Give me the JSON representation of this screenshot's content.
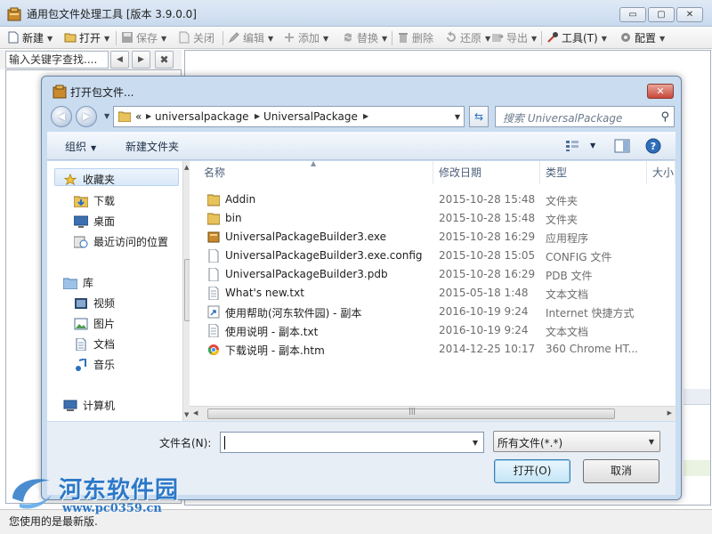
{
  "main_window": {
    "title": "通用包文件处理工具 [版本 3.9.0.0]",
    "controls": {
      "minimize": "▭",
      "maximize": "▢",
      "close": "✕"
    },
    "toolbar": [
      {
        "label": "新建",
        "icon": "new-file-icon",
        "dropdown": true,
        "disabled": false
      },
      {
        "label": "打开",
        "icon": "open-folder-icon",
        "dropdown": true,
        "disabled": false
      },
      {
        "label": "保存",
        "icon": "save-icon",
        "dropdown": true,
        "disabled": true
      },
      {
        "label": "关闭",
        "icon": "close-file-icon",
        "dropdown": false,
        "disabled": true
      },
      {
        "label": "编辑",
        "icon": "edit-icon",
        "dropdown": true,
        "disabled": true
      },
      {
        "label": "添加",
        "icon": "add-icon",
        "dropdown": true,
        "disabled": true
      },
      {
        "label": "替换",
        "icon": "replace-icon",
        "dropdown": true,
        "disabled": true
      },
      {
        "label": "删除",
        "icon": "delete-icon",
        "dropdown": false,
        "disabled": true
      },
      {
        "label": "还原",
        "icon": "restore-icon",
        "dropdown": true,
        "disabled": true
      },
      {
        "label": "导出",
        "icon": "export-icon",
        "dropdown": true,
        "disabled": true
      },
      {
        "label": "工具(T)",
        "icon": "tools-icon",
        "dropdown": true,
        "disabled": false
      },
      {
        "label": "配置",
        "icon": "gear-icon",
        "dropdown": true,
        "disabled": false
      }
    ],
    "search_placeholder": "输入关键字查找....",
    "nav_prev": "◀",
    "nav_next": "▶",
    "clear_symbol": "✖",
    "status": "您使用的是最新版."
  },
  "dialog": {
    "title": "打开包文件...",
    "close_symbol": "✕",
    "back_symbol": "◀",
    "forward_symbol": "▶",
    "address": {
      "overflow": "«",
      "items": [
        "universalpackage",
        "UniversalPackage"
      ]
    },
    "refresh_symbol": "⇆",
    "search_placeholder": "搜索 UniversalPackage",
    "toolbar": {
      "organize": "组织",
      "new_folder": "新建文件夹"
    },
    "nav": {
      "favorites": "收藏夹",
      "favorites_items": [
        "下载",
        "桌面",
        "最近访问的位置"
      ],
      "libraries": "库",
      "library_items": [
        "视频",
        "图片",
        "文档",
        "音乐"
      ],
      "computer": "计算机"
    },
    "columns": {
      "name": "名称",
      "date": "修改日期",
      "type": "类型",
      "size": "大小"
    },
    "files": [
      {
        "name": "Addin",
        "date": "2015-10-28 15:48",
        "type": "文件夹",
        "icon": "folder-icon"
      },
      {
        "name": "bin",
        "date": "2015-10-28 15:48",
        "type": "文件夹",
        "icon": "folder-icon"
      },
      {
        "name": "UniversalPackageBuilder3.exe",
        "date": "2015-10-28 16:29",
        "type": "应用程序",
        "icon": "exe-icon"
      },
      {
        "name": "UniversalPackageBuilder3.exe.config",
        "date": "2015-10-28 15:05",
        "type": "CONFIG 文件",
        "icon": "file-icon"
      },
      {
        "name": "UniversalPackageBuilder3.pdb",
        "date": "2015-10-28 16:29",
        "type": "PDB 文件",
        "icon": "file-icon"
      },
      {
        "name": "What's new.txt",
        "date": "2015-05-18 1:48",
        "type": "文本文档",
        "icon": "text-file-icon"
      },
      {
        "name": "使用帮助(河东软件园) - 副本",
        "date": "2016-10-19 9:24",
        "type": "Internet 快捷方式",
        "icon": "shortcut-icon"
      },
      {
        "name": "使用说明 - 副本.txt",
        "date": "2016-10-19 9:24",
        "type": "文本文档",
        "icon": "text-file-icon"
      },
      {
        "name": "下载说明 - 副本.htm",
        "date": "2014-12-25 10:17",
        "type": "360 Chrome HT...",
        "icon": "browser-file-icon"
      }
    ],
    "filename_label": "文件名(N):",
    "filename_value": "",
    "filter": "所有文件(*.*)",
    "open_button": "打开(O)",
    "cancel_button": "取消"
  },
  "watermark": {
    "text": "河东软件园",
    "url": "www.pc0359.cn"
  },
  "colors": {
    "accent": "#2c78c8",
    "dialog_frame": "#c9dcf0",
    "folder": "#e8c25a"
  }
}
